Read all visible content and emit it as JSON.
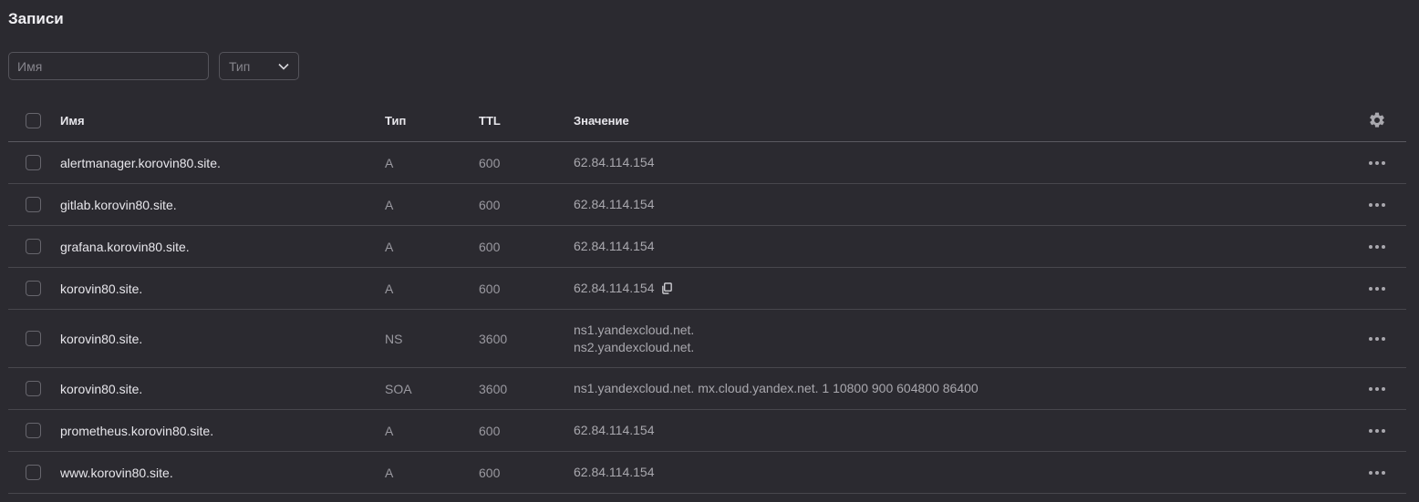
{
  "page": {
    "title": "Записи"
  },
  "filters": {
    "name_placeholder": "Имя",
    "type_placeholder": "Тип"
  },
  "table": {
    "columns": {
      "name": "Имя",
      "type": "Тип",
      "ttl": "TTL",
      "value": "Значение"
    },
    "rows": [
      {
        "name": "alertmanager.korovin80.site.",
        "type": "A",
        "ttl": "600",
        "value": [
          "62.84.114.154"
        ]
      },
      {
        "name": "gitlab.korovin80.site.",
        "type": "A",
        "ttl": "600",
        "value": [
          "62.84.114.154"
        ]
      },
      {
        "name": "grafana.korovin80.site.",
        "type": "A",
        "ttl": "600",
        "value": [
          "62.84.114.154"
        ]
      },
      {
        "name": "korovin80.site.",
        "type": "A",
        "ttl": "600",
        "value": [
          "62.84.114.154"
        ],
        "copy_icon": true
      },
      {
        "name": "korovin80.site.",
        "type": "NS",
        "ttl": "3600",
        "value": [
          "ns1.yandexcloud.net.",
          "ns2.yandexcloud.net."
        ]
      },
      {
        "name": "korovin80.site.",
        "type": "SOA",
        "ttl": "3600",
        "value": [
          "ns1.yandexcloud.net. mx.cloud.yandex.net. 1 10800 900 604800 86400"
        ]
      },
      {
        "name": "prometheus.korovin80.site.",
        "type": "A",
        "ttl": "600",
        "value": [
          "62.84.114.154"
        ]
      },
      {
        "name": "www.korovin80.site.",
        "type": "A",
        "ttl": "600",
        "value": [
          "62.84.114.154"
        ]
      }
    ]
  },
  "icons": {
    "settings": "gear-icon",
    "row_menu": "more-horizontal-icon",
    "copy": "copy-icon",
    "dropdown": "chevron-down-icon"
  },
  "colors": {
    "background": "#2b2a30",
    "border": "#48474d",
    "text": "#e7e6eb",
    "muted": "#9a99a0"
  }
}
